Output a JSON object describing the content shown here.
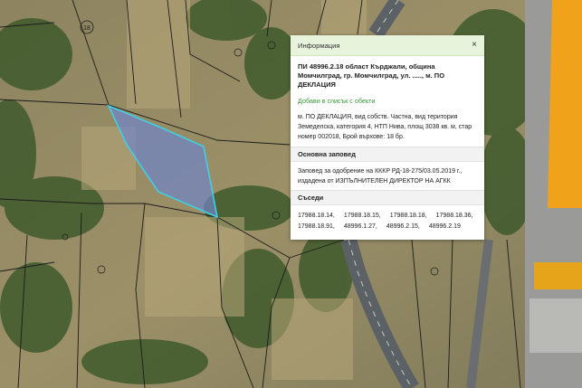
{
  "map": {
    "parcel_label": "18",
    "colors": {
      "parcel_fill": "#6f85c8",
      "parcel_stroke": "#3fd0e8",
      "building_orange": "#f0a21a",
      "road": "#5c6166"
    }
  },
  "panel": {
    "title": "Информация",
    "close_icon": "×",
    "parcel_title": "ПИ 48996.2.18 област Кърджали, община Момчилград, гр. Момчилград, ул. ....., м. ПО ДЕКЛАЦИЯ",
    "add_link": "Добави в списък с обекти",
    "description": "м. ПО ДЕКЛАЦИЯ, вид собств. Частна, вид територия Земеделска, категория 4, НТП Нива, площ 3038 кв. м, стар номер 002018, Брой върхове: 18 бр.",
    "order_header": "Основна заповед",
    "order_text": "Заповед за одобрение на КККР РД-18-275/03.05.2019 г., издадена от ИЗПЪЛНИТЕЛЕН ДИРЕКТОР НА АГКК",
    "neighbors_header": "Съседи",
    "neighbors": [
      "17988.18.14,",
      "17988.18.15,",
      "17988.18.18,",
      "17988.18.36,",
      "17988.18.91,",
      "48996.1.27,",
      "48996.2.15,",
      "48996.2.19"
    ]
  }
}
